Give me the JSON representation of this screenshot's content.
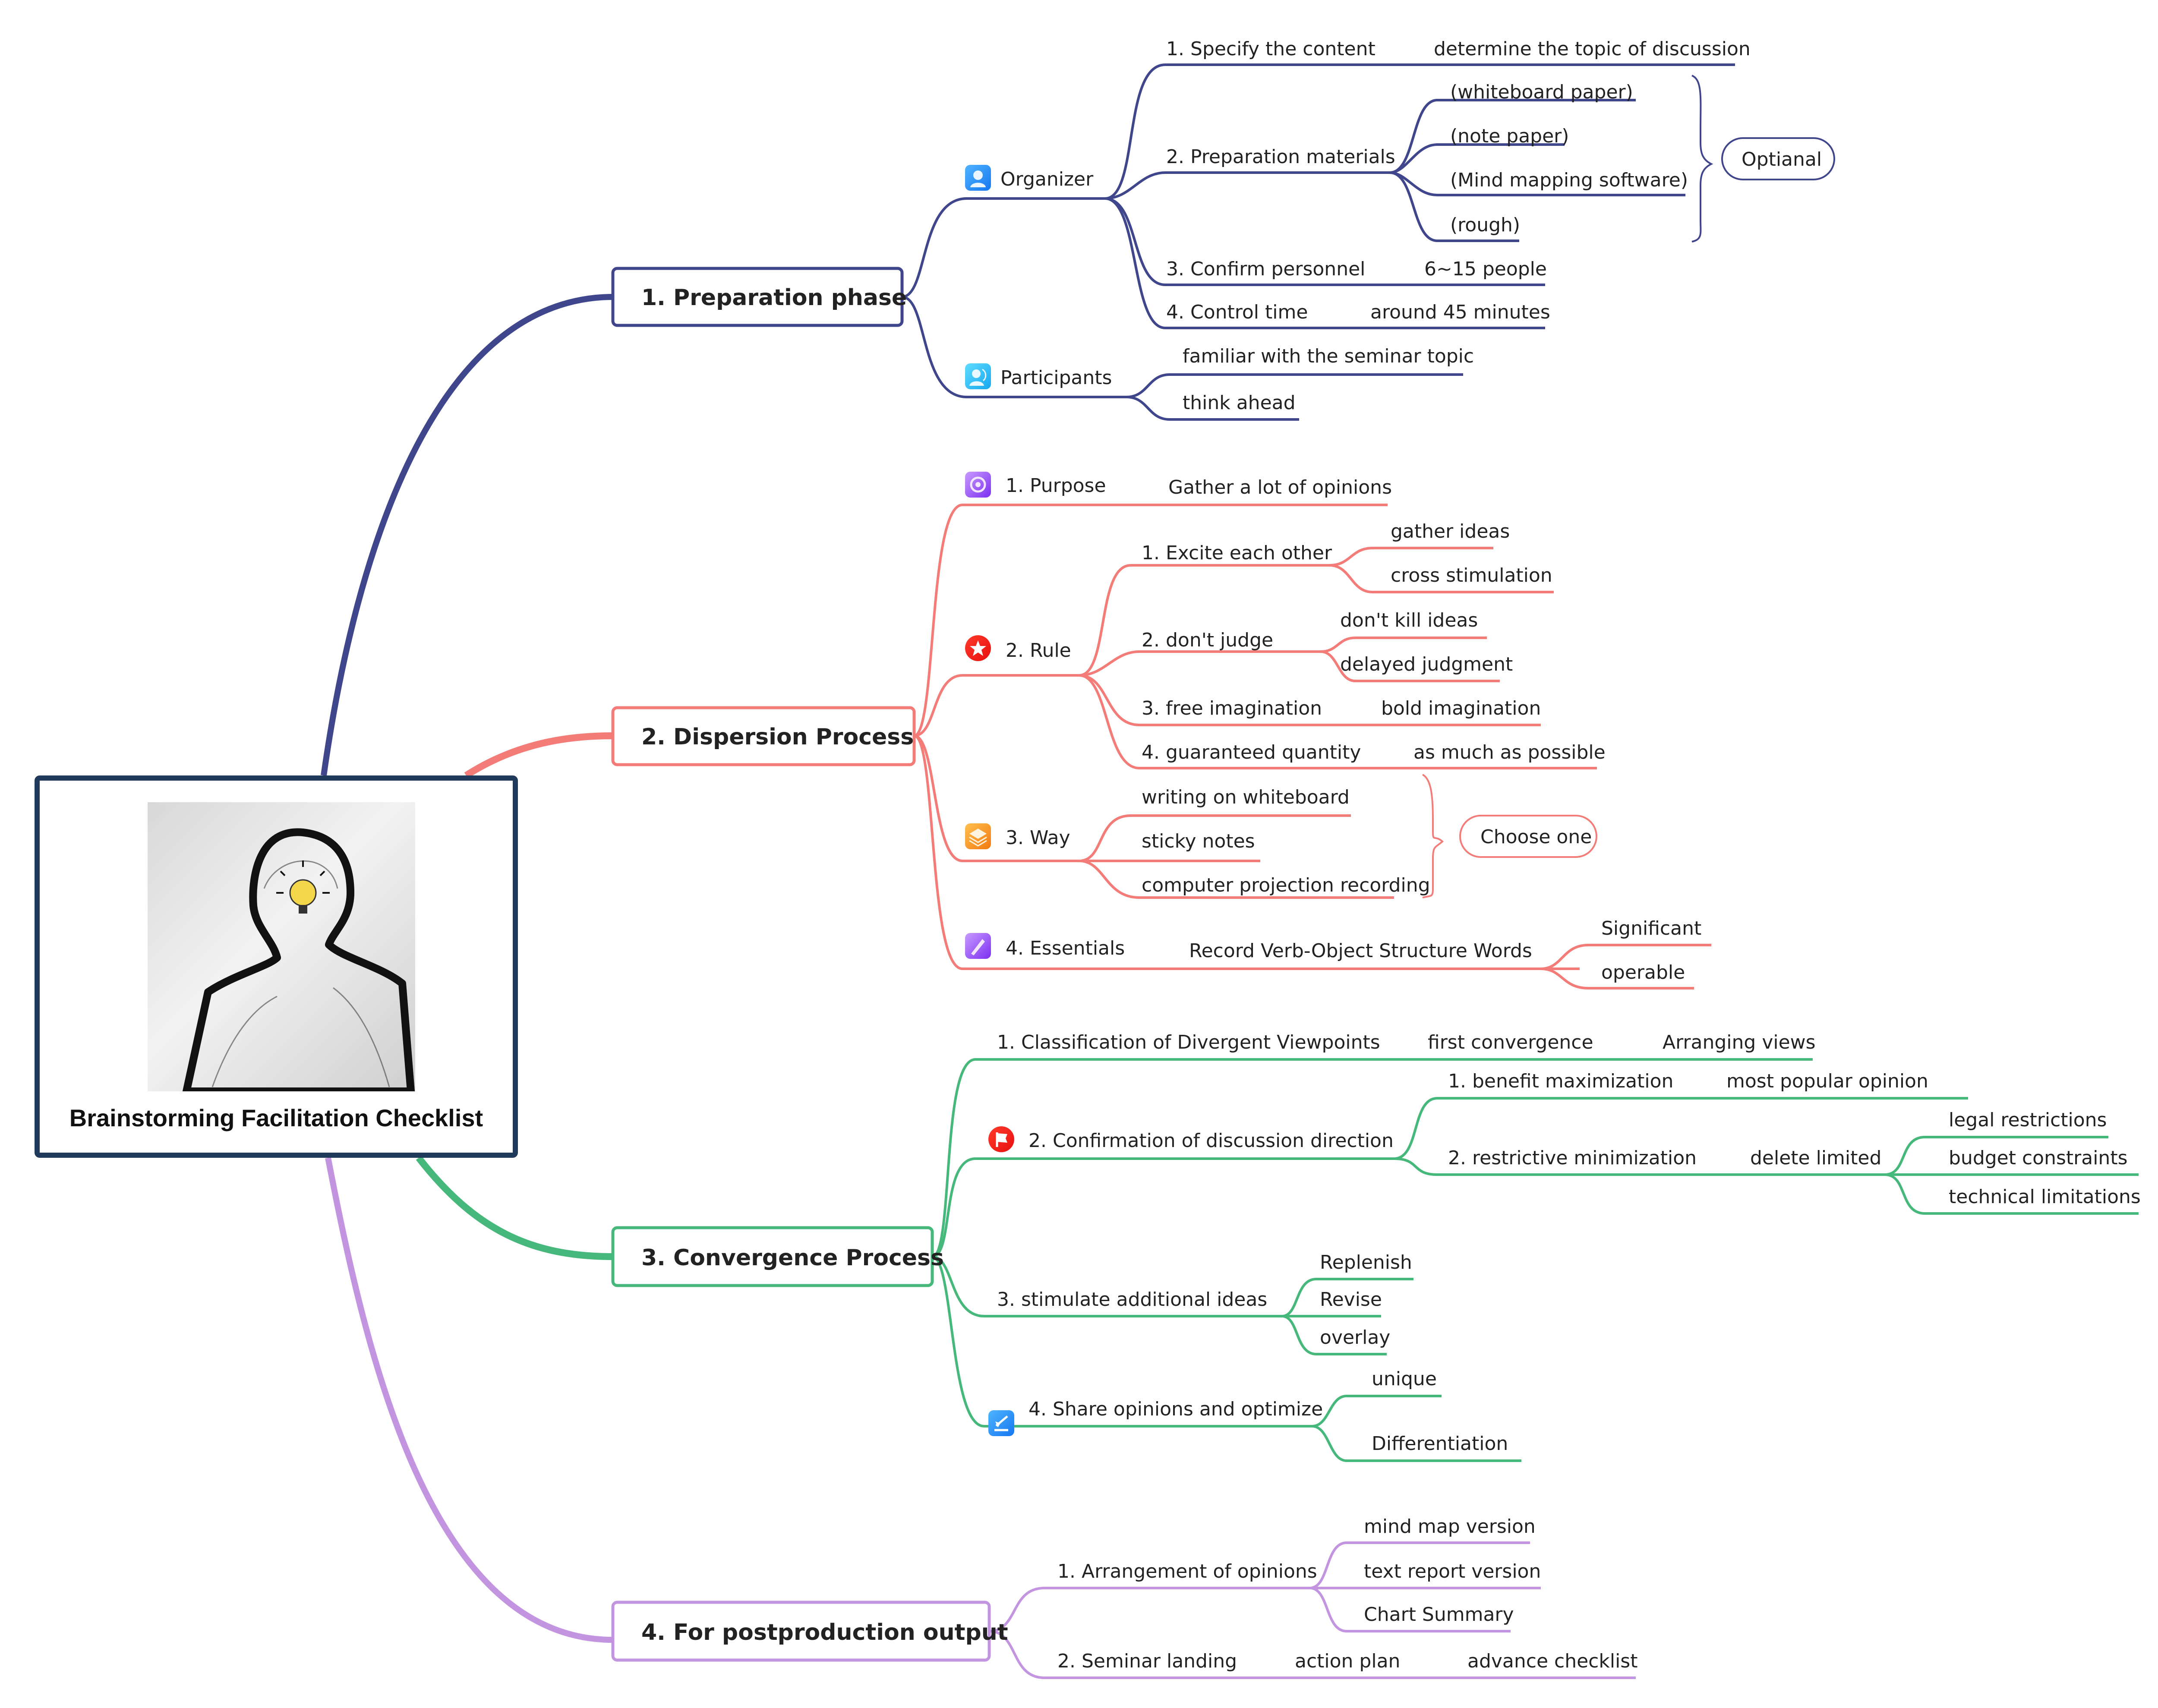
{
  "root": {
    "title": "Brainstorming Facilitation Checklist",
    "image": "person-silhouette-with-lightbulb"
  },
  "colors": {
    "root_border": "#1f3a5a",
    "branch1": "#3f468c",
    "branch2": "#f47c78",
    "branch3": "#47b87c",
    "branch4": "#c394e0"
  },
  "branches": [
    {
      "label": "1. Preparation phase",
      "children": [
        {
          "label": "Organizer",
          "icon": "person-icon",
          "children": [
            {
              "label": "1. Specify the content",
              "children": [
                {
                  "label": "determine the topic of discussion"
                }
              ]
            },
            {
              "label": "2. Preparation materials",
              "children": [
                {
                  "label": "(whiteboard paper)"
                },
                {
                  "label": "(note paper)"
                },
                {
                  "label": "(Mind mapping software)"
                },
                {
                  "label": "(rough)"
                }
              ],
              "summary": "Optianal"
            },
            {
              "label": "3. Confirm personnel",
              "children": [
                {
                  "label": "6~15 people"
                }
              ]
            },
            {
              "label": "4. Control time",
              "children": [
                {
                  "label": "around 45 minutes"
                }
              ]
            }
          ]
        },
        {
          "label": "Participants",
          "icon": "people-icon",
          "children": [
            {
              "label": "familiar with the seminar topic"
            },
            {
              "label": "think ahead"
            }
          ]
        }
      ]
    },
    {
      "label": "2. Dispersion Process",
      "children": [
        {
          "label": "1. Purpose",
          "icon": "target-icon",
          "children": [
            {
              "label": "Gather a lot of opinions"
            }
          ]
        },
        {
          "label": "2. Rule",
          "icon": "star-icon",
          "children": [
            {
              "label": "1. Excite each other",
              "children": [
                {
                  "label": "gather ideas"
                },
                {
                  "label": "cross stimulation"
                }
              ]
            },
            {
              "label": "2. don't judge",
              "children": [
                {
                  "label": "don't kill ideas"
                },
                {
                  "label": "delayed judgment"
                }
              ]
            },
            {
              "label": "3. free imagination",
              "children": [
                {
                  "label": "bold imagination"
                }
              ]
            },
            {
              "label": "4. guaranteed quantity",
              "children": [
                {
                  "label": "as much as possible"
                }
              ]
            }
          ]
        },
        {
          "label": "3. Way",
          "icon": "layers-icon",
          "children": [
            {
              "label": "writing on whiteboard"
            },
            {
              "label": "sticky notes"
            },
            {
              "label": "computer projection recording"
            }
          ],
          "summary": "Choose one"
        },
        {
          "label": "4. Essentials",
          "icon": "pen-icon",
          "children": [
            {
              "label": "Record Verb-Object Structure Words",
              "children": [
                {
                  "label": "Significant"
                },
                {
                  "label": "operable"
                }
              ]
            }
          ]
        }
      ]
    },
    {
      "label": "3. Convergence Process",
      "children": [
        {
          "label": "1. Classification of Divergent Viewpoints",
          "children": [
            {
              "label": "first convergence",
              "children": [
                {
                  "label": "Arranging views"
                }
              ]
            }
          ]
        },
        {
          "label": "2. Confirmation of discussion direction",
          "icon": "flag-icon",
          "children": [
            {
              "label": "1. benefit maximization",
              "children": [
                {
                  "label": "most popular opinion"
                }
              ]
            },
            {
              "label": "2. restrictive minimization",
              "children": [
                {
                  "label": "delete limited",
                  "children": [
                    {
                      "label": "legal restrictions"
                    },
                    {
                      "label": "budget constraints"
                    },
                    {
                      "label": "technical limitations"
                    }
                  ]
                }
              ]
            }
          ]
        },
        {
          "label": "3. stimulate additional ideas",
          "children": [
            {
              "label": "Replenish"
            },
            {
              "label": "Revise"
            },
            {
              "label": "overlay"
            }
          ]
        },
        {
          "label": "4. Share opinions and optimize",
          "icon": "share-icon",
          "children": [
            {
              "label": "unique"
            },
            {
              "label": "Differentiation"
            }
          ]
        }
      ]
    },
    {
      "label": "4. For postproduction output",
      "children": [
        {
          "label": "1. Arrangement of opinions",
          "children": [
            {
              "label": "mind map version"
            },
            {
              "label": "text report version"
            },
            {
              "label": "Chart Summary"
            }
          ]
        },
        {
          "label": "2. Seminar landing",
          "children": [
            {
              "label": "action plan",
              "children": [
                {
                  "label": "advance checklist"
                }
              ]
            }
          ]
        }
      ]
    }
  ]
}
